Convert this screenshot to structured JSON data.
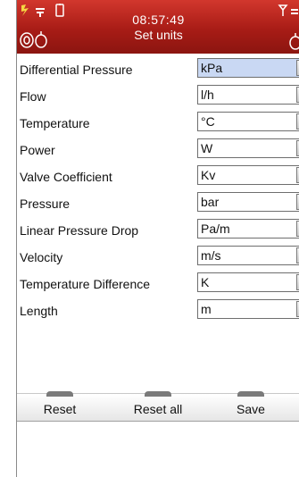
{
  "header": {
    "time": "08:57:49",
    "title": "Set units",
    "icons": [
      "battery-icon",
      "signal-icon",
      "device-icon",
      "wireless-icon"
    ],
    "background": "#b0201a"
  },
  "units": [
    {
      "label": "Differential Pressure",
      "value": "kPa",
      "selected": true
    },
    {
      "label": "Flow",
      "value": "l/h"
    },
    {
      "label": "Temperature",
      "value": "°C"
    },
    {
      "label": "Power",
      "value": "W"
    },
    {
      "label": "Valve Coefficient",
      "value": "Kv"
    },
    {
      "label": "Pressure",
      "value": "bar"
    },
    {
      "label": "Linear Pressure Drop",
      "value": "Pa/m"
    },
    {
      "label": "Velocity",
      "value": "m/s"
    },
    {
      "label": "Temperature Difference",
      "value": "K"
    },
    {
      "label": "Length",
      "value": "m"
    }
  ],
  "softkeys": [
    "Reset",
    "Reset all",
    "Save"
  ]
}
